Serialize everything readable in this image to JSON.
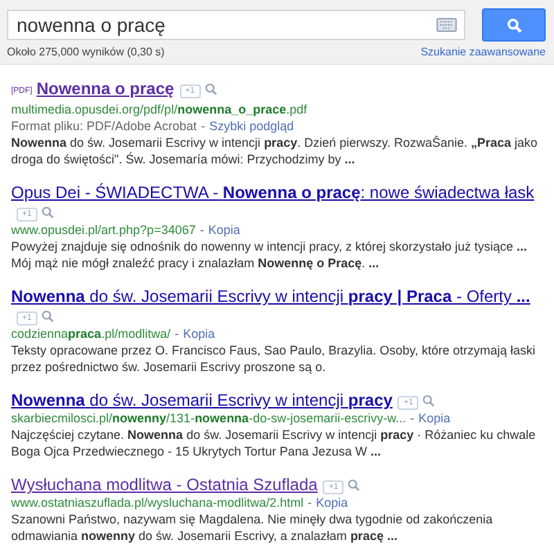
{
  "search": {
    "query": "nowenna o pracę",
    "stats": "Około 275,000 wyników (0,30 s)",
    "advanced_link": "Szukanie zaawansowane"
  },
  "results": [
    {
      "tag": "[PDF]",
      "title": "**Nowenna o pracę**",
      "visited": true,
      "plus_one": "+1",
      "url": "multimedia.opusdei.org/pdf/pl/**nowenna_o_prace**.pdf",
      "file_format": "Format pliku: PDF/Adobe Acrobat",
      "separator": "-",
      "quick_view": "Szybki podgląd",
      "snippet": "**Nowenna** do św. Josemarii Escrivy w intencji **pracy**. Dzień pierwszy. RozwaŜanie. **„Praca** jako droga do świętości\". Św. Josemaría mówi: Przychodzimy by **...**"
    },
    {
      "title": "Opus Dei - ŚWIADECTWA - **Nowenna o pracę**: nowe świadectwa łask",
      "visited": false,
      "plus_one": "+1",
      "url": "www.opusdei.pl/art.php?p=34067",
      "separator": "-",
      "cache": "Kopia",
      "snippet": "Powyżej znajduje się odnośnik do nowenny w intencji pracy, z której skorzystało już tysiące **...** Mój mąż nie mógł znaleźć pracy i znalazłam **Nowennę o Pracę**. **...**"
    },
    {
      "title": "**Nowenna** do św. Josemarii Escrivy w intencji **pracy | Praca** - Oferty **...**",
      "visited": false,
      "plus_one": "+1",
      "url": "codzienna**praca**.pl/modlitwa/",
      "separator": "-",
      "cache": "Kopia",
      "snippet": "Teksty opracowane przez O. Francisco Faus, Sao Paulo, Brazylia. Osoby, które otrzymają łaski przez pośrednictwo św. Josemarii Escrivy proszone są o."
    },
    {
      "title": "**Nowenna** do św. Josemarii Escrivy w intencji **pracy**",
      "visited": false,
      "plus_one": "+1",
      "url": "skarbiecmilosci.pl/**nowenny**/131-**nowenna**-do-sw-josemarii-escrivy-w...",
      "separator": "-",
      "cache": "Kopia",
      "snippet": "Najczęściej czytane. **Nowenna** do św. Josemarii Escrivy w intencji **pracy** · Różaniec ku chwale Boga Ojca Przedwiecznego - 15 Ukrytych Tortur Pana Jezusa W **...**"
    },
    {
      "title": "Wysłuchana modlitwa - Ostatnia Szuflada",
      "visited": true,
      "plus_one": "+1",
      "url": "www.ostatniaszuflada.pl/wysluchana-modlitwa/2.html",
      "separator": "-",
      "cache": "Kopia",
      "snippet": "Szanowni Państwo, nazywam się Magdalena. Nie minęły dwa tygodnie od zakończenia odmawiania **nowenny** do św. Josemarii Escrivy, a znalazłam **pracę** **...**"
    }
  ]
}
